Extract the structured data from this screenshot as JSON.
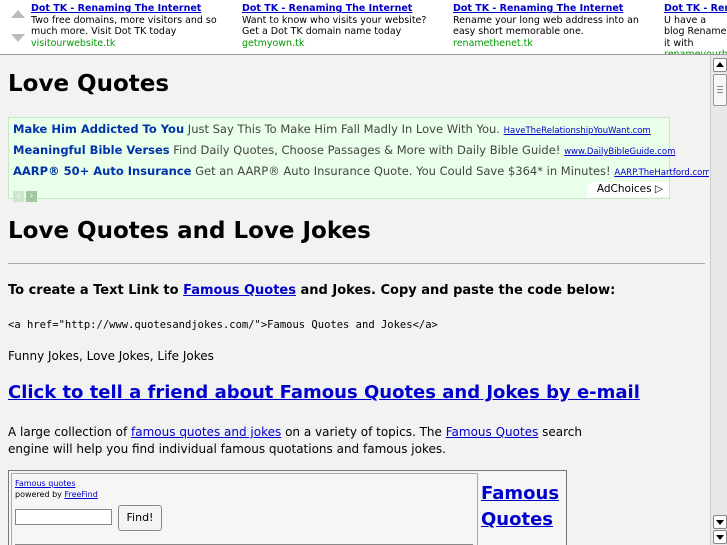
{
  "top_ads": [
    {
      "title": "Dot TK - Renaming The Internet",
      "desc": "Two free domains, more visitors and so much more. Visit Dot TK today",
      "url": "visitourwebsite.tk"
    },
    {
      "title": "Dot TK - Renaming The Internet",
      "desc": "Want to know who visits your website? Get a Dot TK domain name today",
      "url": "getmyown.tk"
    },
    {
      "title": "Dot TK - Renaming The Internet",
      "desc": "Rename your long web address into an easy short memorable one.",
      "url": "renamethenet.tk"
    },
    {
      "title": "Dot TK - Rena",
      "desc": "U have a blog Rename it with",
      "url": "renameyourbl"
    }
  ],
  "page_title": "Love Quotes",
  "ad_block": {
    "rows": [
      {
        "title": "Make Him Addicted To You",
        "desc": "Just Say This To Make Him Fall Madly In Love With You.",
        "url": "HaveTheRelationshipYouWant.com"
      },
      {
        "title": "Meaningful Bible Verses",
        "desc": "Find Daily Quotes, Choose Passages & More with Daily Bible Guide!",
        "url": "www.DailyBibleGuide.com"
      },
      {
        "title": "AARP® 50+ Auto Insurance",
        "desc": "Get an AARP® Auto Insurance Quote. You Could Save $364* in Minutes!",
        "url": "AARP.TheHartford.com"
      }
    ],
    "prev_glyph": "‹",
    "next_glyph": "›",
    "adchoices": "AdChoices ▷"
  },
  "sub_title": "Love Quotes and Love Jokes",
  "textlink": {
    "prefix": "To create a Text Link to ",
    "link": "Famous Quotes",
    "suffix": " and Jokes. Copy and paste the code below:"
  },
  "code_snippet": "<a href=\"http://www.quotesandjokes.com/\">Famous Quotes and Jokes</a>",
  "jokes_line": "Funny Jokes, Love Jokes, Life Jokes",
  "tell_friend": "Click to tell a friend about Famous Quotes and Jokes by e-mail",
  "collection": {
    "p1": "A large collection of ",
    "link1": "famous quotes and jokes",
    "p2": " on a variety of topics. The ",
    "link2": "Famous Quotes",
    "p3": " search engine will help you find individual famous quotations and famous jokes."
  },
  "freefind": {
    "link": "Famous quotes",
    "powered_prefix": "powered by ",
    "powered_link": "FreeFind",
    "button": "Find!",
    "side_line1": "Famous",
    "side_line2": "Quotes"
  }
}
